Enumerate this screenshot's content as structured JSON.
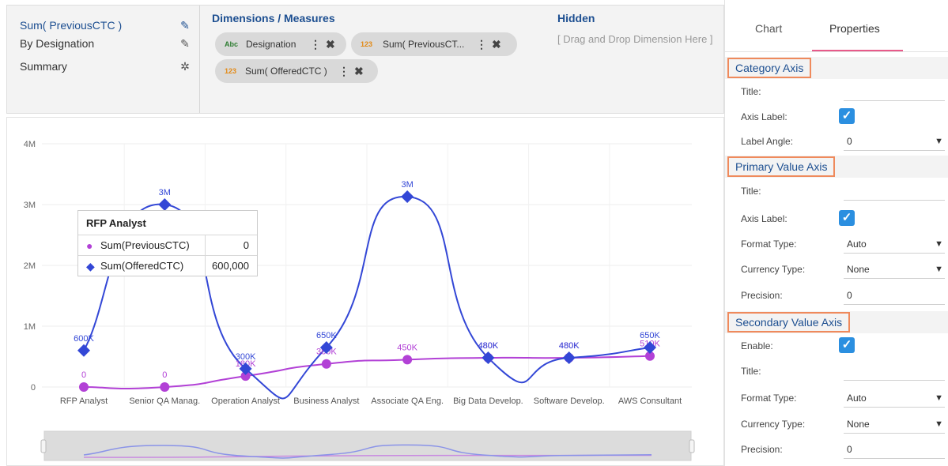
{
  "config_list": [
    {
      "label": "Sum( PreviousCTC )",
      "icon": "pencil-icon",
      "active": true
    },
    {
      "label": "By Designation",
      "icon": "pencil-icon",
      "active": false
    },
    {
      "label": "Summary",
      "icon": "gear-icon",
      "active": false
    }
  ],
  "dimensions": {
    "title": "Dimensions / Measures",
    "pills": [
      {
        "type_tag": "Abc",
        "label": "Designation"
      },
      {
        "type_tag": "123",
        "label": "Sum( PreviousCT..."
      },
      {
        "type_tag": "123",
        "label": "Sum( OfferedCTC )"
      }
    ]
  },
  "hidden": {
    "title": "Hidden",
    "hint": "[ Drag and Drop Dimension Here ]"
  },
  "tabs": [
    {
      "label": "Chart",
      "active": false
    },
    {
      "label": "Properties",
      "active": true
    }
  ],
  "properties": {
    "category_axis": {
      "header": "Category Axis",
      "title_label": "Title:",
      "title_value": "",
      "axis_label_label": "Axis Label:",
      "axis_label_checked": true,
      "label_angle_label": "Label Angle:",
      "label_angle_value": "0"
    },
    "primary_value_axis": {
      "header": "Primary Value Axis",
      "title_label": "Title:",
      "title_value": "",
      "axis_label_label": "Axis Label:",
      "axis_label_checked": true,
      "format_type_label": "Format Type:",
      "format_type_value": "Auto",
      "currency_type_label": "Currency Type:",
      "currency_type_value": "None",
      "precision_label": "Precision:",
      "precision_value": "0"
    },
    "secondary_value_axis": {
      "header": "Secondary Value Axis",
      "enable_label": "Enable:",
      "enable_checked": true,
      "title_label": "Title:",
      "title_value": "",
      "format_type_label": "Format Type:",
      "format_type_value": "Auto",
      "currency_type_label": "Currency Type:",
      "currency_type_value": "None",
      "precision_label": "Precision:",
      "precision_value": "0"
    }
  },
  "tooltip": {
    "title": "RFP Analyst",
    "rows": [
      {
        "name": "Sum(PreviousCTC)",
        "value": "0",
        "marker": "circle"
      },
      {
        "name": "Sum(OfferedCTC)",
        "value": "600,000",
        "marker": "diamond"
      }
    ]
  },
  "colors": {
    "offered_series": "#3347d6",
    "previous_series": "#b241d6",
    "accent": "#1d4f91",
    "highlight_border": "#ef8a5c",
    "tab_underline": "#e85a8a",
    "checkbox": "#2b8fe0"
  },
  "chart_data": {
    "type": "line",
    "categories": [
      "RFP Analyst",
      "Senior QA Manag.",
      "Operation Analyst",
      "Business Analyst",
      "Associate QA Eng.",
      "Big Data Develop.",
      "Software Develop.",
      "AWS Consultant"
    ],
    "series": [
      {
        "name": "Sum(OfferedCTC)",
        "values": [
          600000,
          3000000,
          300000,
          650000,
          3130000,
          480000,
          480000,
          650000
        ],
        "labels": [
          "600K",
          "3M",
          "300K",
          "650K",
          "3M",
          "480K",
          "480K",
          "650K"
        ],
        "marker": "diamond"
      },
      {
        "name": "Sum(PreviousCTC)",
        "values": [
          0,
          0,
          180000,
          380000,
          450000,
          480000,
          480000,
          510000
        ],
        "labels": [
          "0",
          "0",
          "180K",
          "380K",
          "450K",
          "480K",
          "480K",
          "510K"
        ],
        "marker": "circle"
      }
    ],
    "y_ticks": [
      "0",
      "1M",
      "2M",
      "3M",
      "4M"
    ],
    "ylim": [
      0,
      4000000
    ],
    "grid": true,
    "legend": "none",
    "navigator": true
  }
}
